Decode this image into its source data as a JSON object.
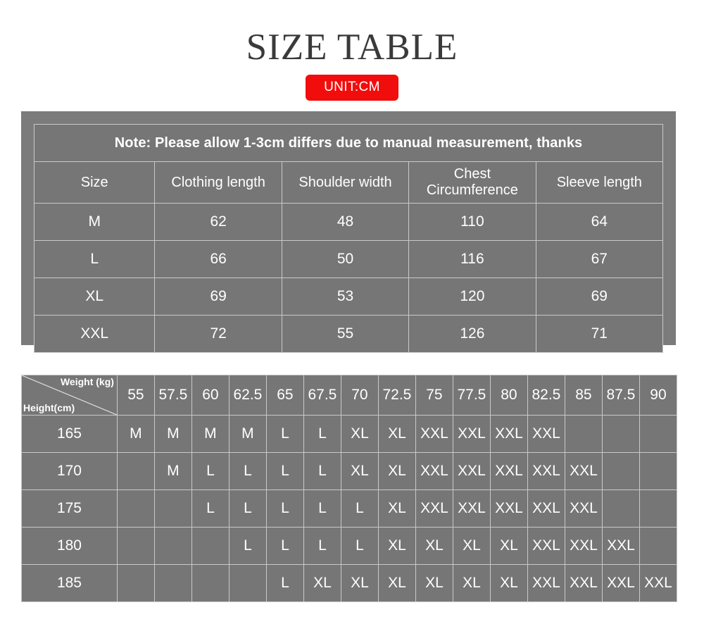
{
  "header": {
    "title": "SIZE TABLE",
    "unit_badge": "UNIT:CM",
    "badge_color": "#f20d0d"
  },
  "measurement_table": {
    "note": "Note: Please allow 1-3cm differs due to manual measurement, thanks",
    "columns": [
      "Size",
      "Clothing length",
      "Shoulder width",
      "Chest Circumference",
      "Sleeve length"
    ],
    "chest_header_line1": "Chest",
    "chest_header_line2": "Circumference",
    "rows": [
      {
        "size": "M",
        "clothing_length": "62",
        "shoulder_width": "48",
        "chest_circumference": "110",
        "sleeve_length": "64"
      },
      {
        "size": "L",
        "clothing_length": "66",
        "shoulder_width": "50",
        "chest_circumference": "116",
        "sleeve_length": "67"
      },
      {
        "size": "XL",
        "clothing_length": "69",
        "shoulder_width": "53",
        "chest_circumference": "120",
        "sleeve_length": "69"
      },
      {
        "size": "XXL",
        "clothing_length": "72",
        "shoulder_width": "55",
        "chest_circumference": "126",
        "sleeve_length": "71"
      }
    ]
  },
  "recommendation_grid": {
    "corner": {
      "weight_label": "Weight (kg)",
      "height_label": "Height(cm)"
    },
    "weights": [
      "55",
      "57.5",
      "60",
      "62.5",
      "65",
      "67.5",
      "70",
      "72.5",
      "75",
      "77.5",
      "80",
      "82.5",
      "85",
      "87.5",
      "90"
    ],
    "rows": [
      {
        "height": "165",
        "sizes": [
          "M",
          "M",
          "M",
          "M",
          "L",
          "L",
          "XL",
          "XL",
          "XXL",
          "XXL",
          "XXL",
          "XXL",
          "",
          "",
          ""
        ]
      },
      {
        "height": "170",
        "sizes": [
          "",
          "M",
          "L",
          "L",
          "L",
          "L",
          "XL",
          "XL",
          "XXL",
          "XXL",
          "XXL",
          "XXL",
          "XXL",
          "",
          ""
        ]
      },
      {
        "height": "175",
        "sizes": [
          "",
          "",
          "L",
          "L",
          "L",
          "L",
          "L",
          "XL",
          "XXL",
          "XXL",
          "XXL",
          "XXL",
          "XXL",
          "",
          ""
        ]
      },
      {
        "height": "180",
        "sizes": [
          "",
          "",
          "",
          "L",
          "L",
          "L",
          "L",
          "XL",
          "XL",
          "XL",
          "XL",
          "XXL",
          "XXL",
          "XXL",
          ""
        ]
      },
      {
        "height": "185",
        "sizes": [
          "",
          "",
          "",
          "",
          "L",
          "XL",
          "XL",
          "XL",
          "XL",
          "XL",
          "XL",
          "XXL",
          "XXL",
          "XXL",
          "XXL"
        ]
      }
    ]
  },
  "colors": {
    "table_bg": "#767676",
    "block_bg": "#7b7b7b",
    "grid_line": "#c9c9c9",
    "text": "#ffffff",
    "title": "#3a3a3a"
  }
}
